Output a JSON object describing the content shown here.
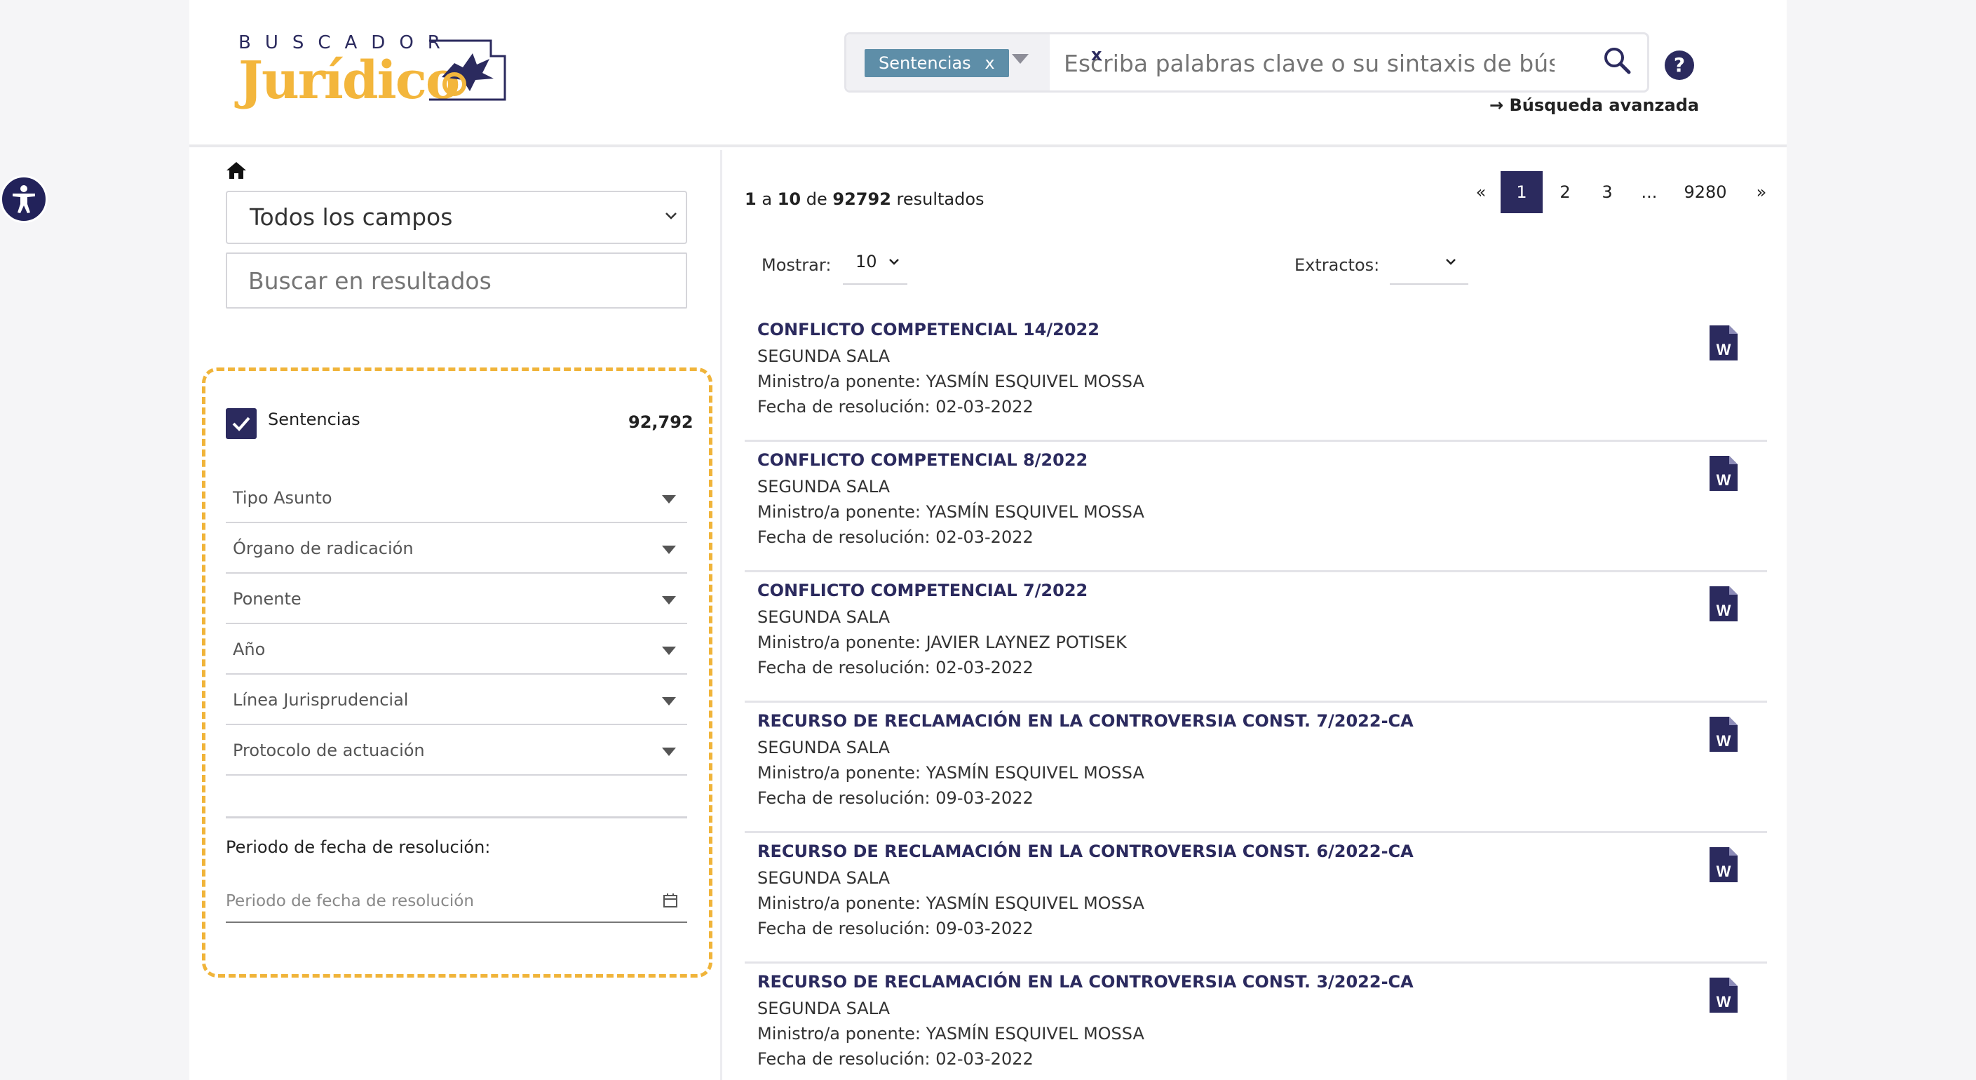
{
  "logo": {
    "small": "BUSCADOR",
    "big": "Jurídico"
  },
  "search": {
    "chip_label": "Sentencias",
    "chip_x": "x",
    "placeholder": "Escriba palabras clave o su sintaxis de búsqued",
    "clear": "x",
    "advanced": "→  Búsqueda avanzada",
    "help": "?"
  },
  "sidebar": {
    "fields_select": "Todos los campos",
    "filter_placeholder": "Buscar en resultados",
    "check_label": "Sentencias",
    "check_count": "92,792",
    "dropdowns": [
      "Tipo Asunto",
      "Órgano de radicación",
      "Ponente",
      "Año",
      "Línea Jurisprudencial",
      "Protocolo de actuación"
    ],
    "period_label": "Periodo de fecha de resolución:",
    "period_placeholder": "Periodo de fecha de resolución"
  },
  "results_header": {
    "c1": "1",
    "c2": "a",
    "c3": "10",
    "c4": "de",
    "c5": "92792",
    "c6": "resultados",
    "mostrar_label": "Mostrar:",
    "mostrar_value": "10",
    "extractos_label": "Extractos:"
  },
  "pagination": [
    "«",
    "1",
    "2",
    "3",
    "...",
    "9280",
    "»"
  ],
  "results": [
    {
      "title": "CONFLICTO COMPETENCIAL 14/2022",
      "sala": "SEGUNDA SALA",
      "ponente": "Ministro/a ponente: YASMÍN ESQUIVEL MOSSA",
      "fecha": "Fecha de resolución: 02-03-2022"
    },
    {
      "title": "CONFLICTO COMPETENCIAL 8/2022",
      "sala": "SEGUNDA SALA",
      "ponente": "Ministro/a ponente: YASMÍN ESQUIVEL MOSSA",
      "fecha": "Fecha de resolución: 02-03-2022"
    },
    {
      "title": "CONFLICTO COMPETENCIAL 7/2022",
      "sala": "SEGUNDA SALA",
      "ponente": "Ministro/a ponente: JAVIER LAYNEZ POTISEK",
      "fecha": "Fecha de resolución: 02-03-2022"
    },
    {
      "title": "RECURSO DE RECLAMACIÓN EN LA CONTROVERSIA CONST. 7/2022-CA",
      "sala": "SEGUNDA SALA",
      "ponente": "Ministro/a ponente: YASMÍN ESQUIVEL MOSSA",
      "fecha": "Fecha de resolución: 09-03-2022"
    },
    {
      "title": "RECURSO DE RECLAMACIÓN EN LA CONTROVERSIA CONST. 6/2022-CA",
      "sala": "SEGUNDA SALA",
      "ponente": "Ministro/a ponente: YASMÍN ESQUIVEL MOSSA",
      "fecha": "Fecha de resolución: 09-03-2022"
    },
    {
      "title": "RECURSO DE RECLAMACIÓN EN LA CONTROVERSIA CONST. 3/2022-CA",
      "sala": "SEGUNDA SALA",
      "ponente": "Ministro/a ponente: YASMÍN ESQUIVEL MOSSA",
      "fecha": "Fecha de resolución: 02-03-2022"
    }
  ],
  "colors": {
    "navy": "#2b2a5e",
    "gold": "#f3b63c",
    "chip": "#5e8ea8"
  },
  "icons": [
    "accessibility-icon",
    "home-icon",
    "search-icon",
    "help-icon",
    "calendar-icon",
    "word-document-icon",
    "chevron-down-icon"
  ]
}
